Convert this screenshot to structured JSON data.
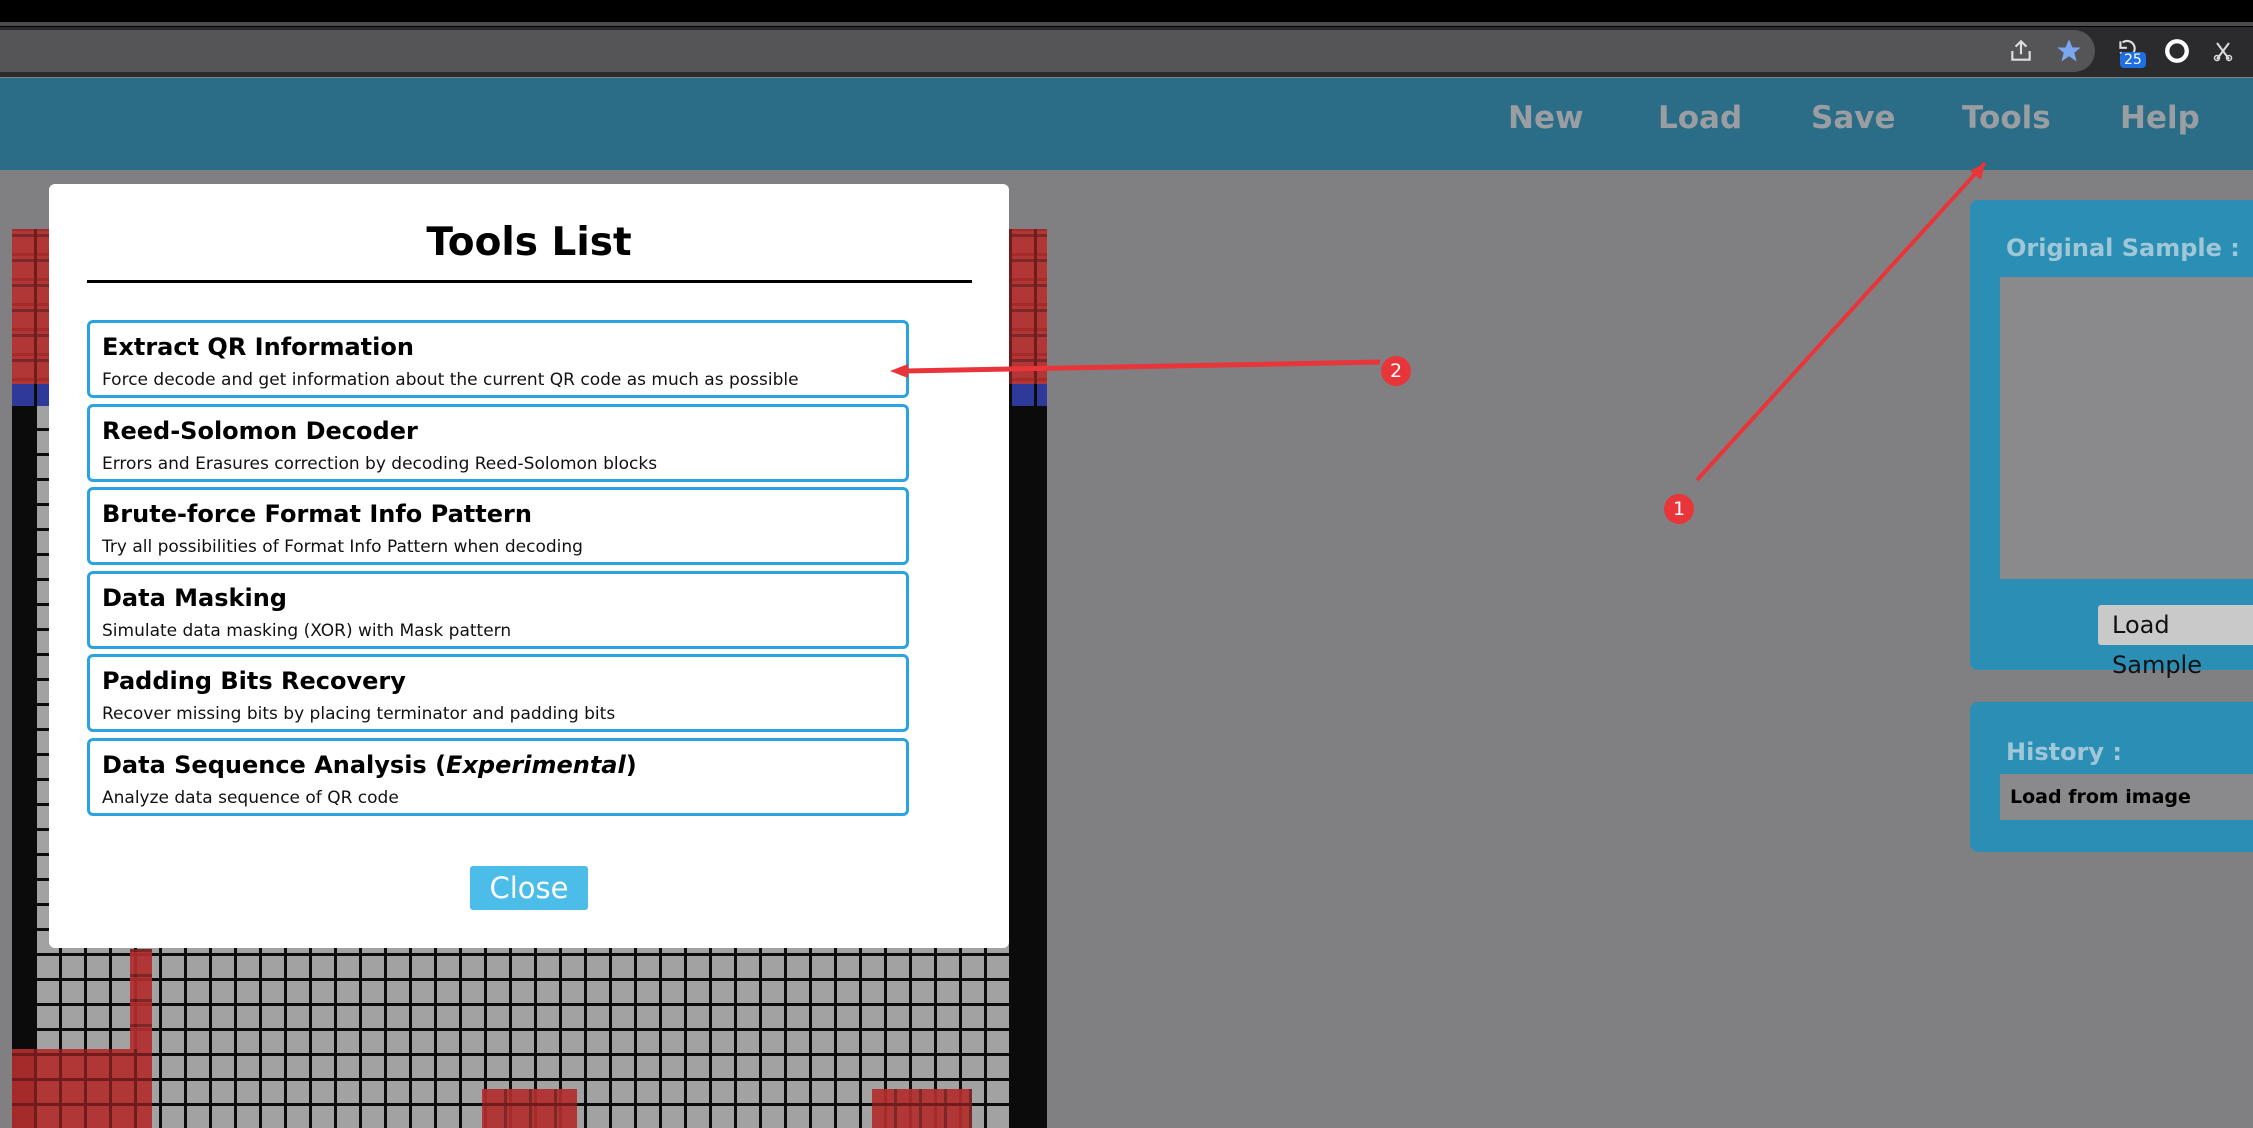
{
  "browser": {
    "badge_count": "25",
    "icons": [
      "share-icon",
      "star-icon",
      "extension-icon",
      "record-icon",
      "scissors-icon"
    ],
    "accent": "#1f6fe0"
  },
  "nav": {
    "items": [
      {
        "label": "New"
      },
      {
        "label": "Load"
      },
      {
        "label": "Save"
      },
      {
        "label": "Tools"
      },
      {
        "label": "Help"
      }
    ]
  },
  "modal": {
    "title": "Tools List",
    "tools": [
      {
        "title": "Extract QR Information",
        "desc": "Force decode and get information about the current QR code as much as possible"
      },
      {
        "title": "Reed-Solomon Decoder",
        "desc": "Errors and Erasures correction by decoding Reed-Solomon blocks"
      },
      {
        "title": "Brute-force Format Info Pattern",
        "desc": "Try all possibilities of Format Info Pattern when decoding"
      },
      {
        "title": "Data Masking",
        "desc": "Simulate data masking (XOR) with Mask pattern"
      },
      {
        "title": "Padding Bits Recovery",
        "desc": "Recover missing bits by placing terminator and padding bits"
      },
      {
        "title_prefix": "Data Sequence Analysis (",
        "title_em": "Experimental",
        "title_suffix": ")",
        "desc": "Analyze data sequence of QR code"
      }
    ],
    "close_label": "Close"
  },
  "sample_panel": {
    "title": "Original Sample :",
    "button": "Load Sample"
  },
  "history_panel": {
    "title": "History :",
    "rows": [
      "Load from image"
    ]
  },
  "annotations": {
    "markers": [
      "1",
      "2"
    ],
    "color": "#e8353a"
  }
}
